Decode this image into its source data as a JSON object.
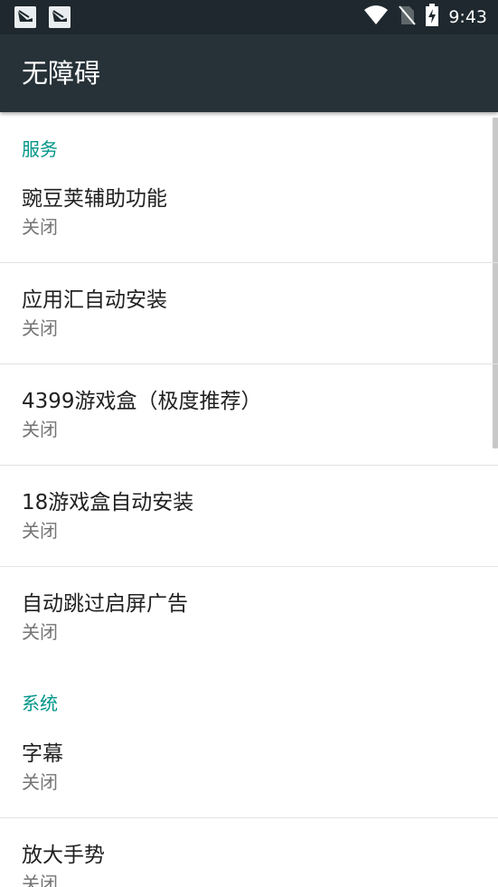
{
  "status_bar": {
    "time": "9:43",
    "icons": [
      "app-notification-icon",
      "app-notification-icon",
      "wifi-icon",
      "no-sim-icon",
      "battery-charging-icon"
    ]
  },
  "app_bar": {
    "title": "无障碍"
  },
  "sections": [
    {
      "header": "服务",
      "items": [
        {
          "title": "豌豆荚辅助功能",
          "summary": "关闭"
        },
        {
          "title": "应用汇自动安装",
          "summary": "关闭"
        },
        {
          "title": "4399游戏盒（极度推荐）",
          "summary": "关闭"
        },
        {
          "title": "18游戏盒自动安装",
          "summary": "关闭"
        },
        {
          "title": "自动跳过启屏广告",
          "summary": "关闭"
        }
      ]
    },
    {
      "header": "系统",
      "items": [
        {
          "title": "字幕",
          "summary": "关闭"
        },
        {
          "title": "放大手势",
          "summary": "关闭"
        }
      ]
    }
  ],
  "colors": {
    "status_bar": "#1e282e",
    "app_bar": "#263238",
    "accent": "#009688",
    "title_text": "#212121",
    "summary_text": "#757575"
  }
}
